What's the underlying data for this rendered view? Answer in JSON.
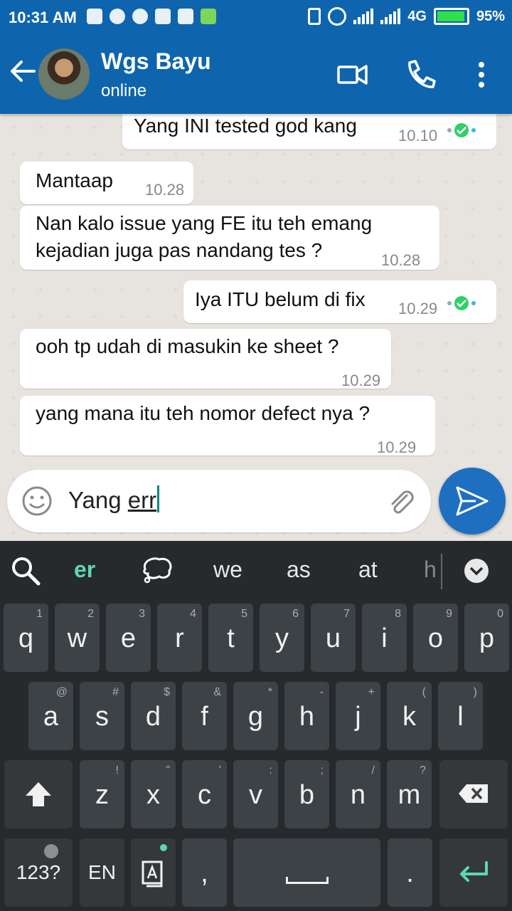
{
  "status_bar": {
    "time": "10:31 AM",
    "network": "4G",
    "battery": "95%"
  },
  "header": {
    "contact_name": "Wgs Bayu",
    "contact_status": "online"
  },
  "messages": [
    {
      "text": "Yang INI tested god kang",
      "time": "10.10",
      "direction": "out",
      "read": true
    },
    {
      "text": "Mantaap",
      "time": "10.28",
      "direction": "in"
    },
    {
      "text": "Nan kalo issue yang FE itu teh emang kejadian juga pas nandang tes ?",
      "line1": "Nan kalo issue yang FE itu teh emang",
      "line2": "kejadian juga pas nandang tes ?",
      "time": "10.28",
      "direction": "in"
    },
    {
      "text": "Iya ITU belum di fix",
      "time": "10.29",
      "direction": "out",
      "read": true
    },
    {
      "text": "ooh tp udah di masukin ke sheet ?",
      "time": "10.29",
      "direction": "in"
    },
    {
      "text": "yang mana itu teh nomor defect nya ?",
      "time": "10.29",
      "direction": "in"
    }
  ],
  "composer": {
    "text_plain": "Yang ",
    "text_composing": "err"
  },
  "keyboard": {
    "suggestions": [
      "er",
      "we",
      "as",
      "at",
      "h"
    ],
    "row1": [
      [
        "q",
        "1"
      ],
      [
        "w",
        "2"
      ],
      [
        "e",
        "3"
      ],
      [
        "r",
        "4"
      ],
      [
        "t",
        "5"
      ],
      [
        "y",
        "6"
      ],
      [
        "u",
        "7"
      ],
      [
        "i",
        "8"
      ],
      [
        "o",
        "9"
      ],
      [
        "p",
        "0"
      ]
    ],
    "row2": [
      [
        "a",
        "@"
      ],
      [
        "s",
        "#"
      ],
      [
        "d",
        "$"
      ],
      [
        "f",
        "&"
      ],
      [
        "g",
        "*"
      ],
      [
        "h",
        "-"
      ],
      [
        "j",
        "+"
      ],
      [
        "k",
        "("
      ],
      [
        "l",
        ")"
      ]
    ],
    "row3": [
      [
        "z",
        "!"
      ],
      [
        "x",
        "\""
      ],
      [
        "c",
        "'"
      ],
      [
        "v",
        ":"
      ],
      [
        "b",
        ";"
      ],
      [
        "n",
        "/"
      ],
      [
        "m",
        "?"
      ]
    ],
    "symbols_label": "123?",
    "language_label": "EN",
    "comma": ",",
    "period": "."
  },
  "colors": {
    "header": "#0e65ad",
    "send": "#1e6fc0",
    "tick_read": "#2fd06a",
    "suggestion_active": "#5fd6b4"
  }
}
